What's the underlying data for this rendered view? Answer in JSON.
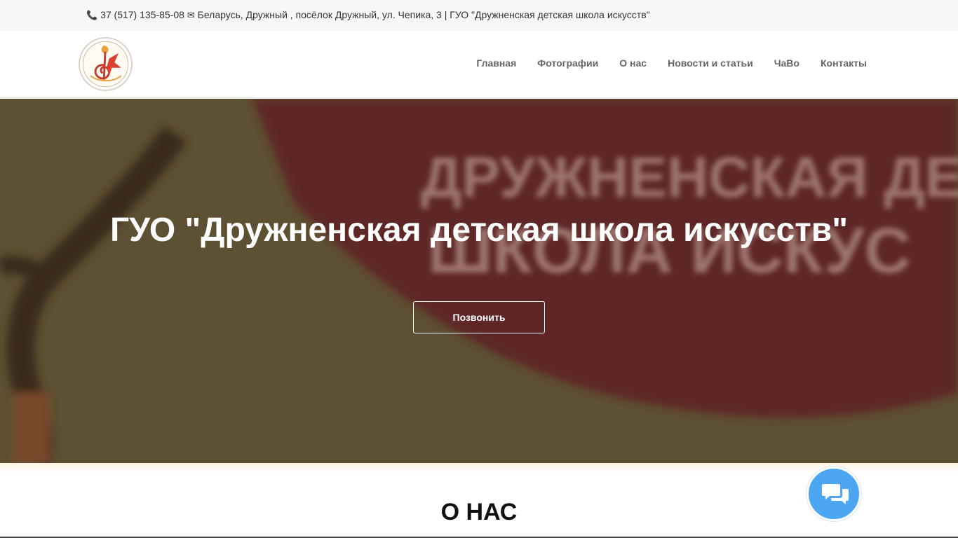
{
  "topbar": {
    "phone_icon": "phone-icon",
    "phone": "37 (517) 135-85-08",
    "mail_icon": "envelope-icon",
    "address": "Беларусь, Дружный , посёлок Дружный, ул. Чепика, 3 | ГУО \"Дружненская детская школа искусств\""
  },
  "logo": {
    "icon": "school-emblem-logo"
  },
  "nav": {
    "items": [
      {
        "label": "Главная"
      },
      {
        "label": "Фотографии"
      },
      {
        "label": "О нас"
      },
      {
        "label": "Новости и статьи"
      },
      {
        "label": "ЧаВо"
      },
      {
        "label": "Контакты"
      }
    ]
  },
  "hero": {
    "title": "ГУО \"Дружненская детская школа искусств\"",
    "button_label": "Позвонить",
    "background_banner_text_line1": "ДРУЖНЕНСКАЯ ДЕТ",
    "background_banner_text_line2": "ШКОЛА ИСКУС"
  },
  "about": {
    "title": "О НАС"
  },
  "chat": {
    "icon": "chat-bubbles-icon"
  },
  "colors": {
    "accent": "#4da6f2",
    "hero_overlay": "#5a4a36",
    "banner_red": "#6b2424"
  }
}
